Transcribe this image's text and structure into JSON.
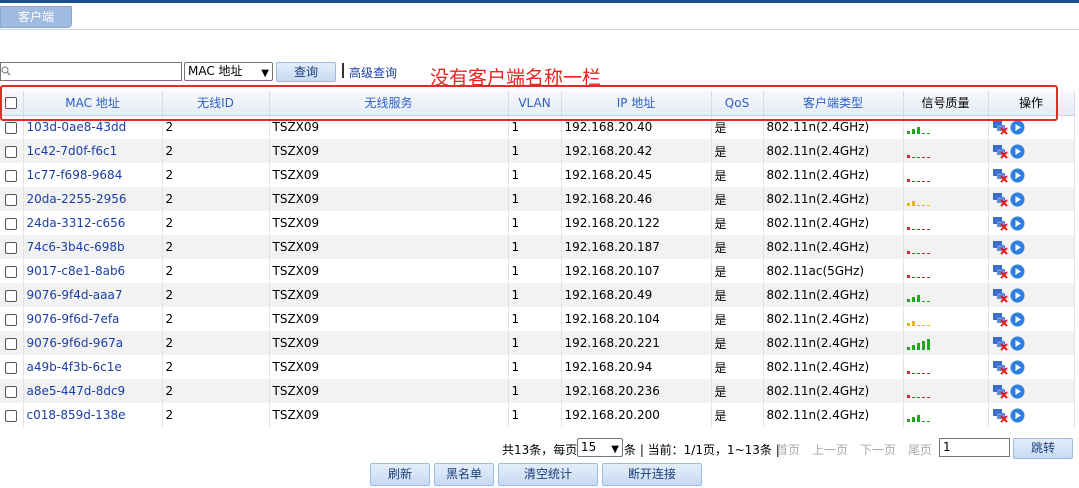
{
  "tab": {
    "label": "客户端"
  },
  "search": {
    "value": "",
    "field_selected": "MAC 地址",
    "query_button": "查询",
    "advanced_link": "高级查询"
  },
  "annotation": "没有客户端名称一栏",
  "table": {
    "headers": [
      "MAC 地址",
      "无线ID",
      "无线服务",
      "VLAN",
      "IP 地址",
      "QoS",
      "客户端类型",
      "信号质量",
      "操作"
    ],
    "rows": [
      {
        "mac": "103d-0ae8-43dd",
        "wid": "2",
        "svc": "TSZX09",
        "vlan": "1",
        "ip": "192.168.20.40",
        "qos": "是",
        "type": "802.11n(2.4GHz)",
        "signal": 3,
        "signal_color": "#1fa81f"
      },
      {
        "mac": "1c42-7d0f-f6c1",
        "wid": "2",
        "svc": "TSZX09",
        "vlan": "1",
        "ip": "192.168.20.42",
        "qos": "是",
        "type": "802.11n(2.4GHz)",
        "signal": 1,
        "signal_color": "#d42a1a"
      },
      {
        "mac": "1c77-f698-9684",
        "wid": "2",
        "svc": "TSZX09",
        "vlan": "1",
        "ip": "192.168.20.45",
        "qos": "是",
        "type": "802.11n(2.4GHz)",
        "signal": 1,
        "signal_color": "#d42a1a"
      },
      {
        "mac": "20da-2255-2956",
        "wid": "2",
        "svc": "TSZX09",
        "vlan": "1",
        "ip": "192.168.20.46",
        "qos": "是",
        "type": "802.11n(2.4GHz)",
        "signal": 2,
        "signal_color": "#e8b800"
      },
      {
        "mac": "24da-3312-c656",
        "wid": "2",
        "svc": "TSZX09",
        "vlan": "1",
        "ip": "192.168.20.122",
        "qos": "是",
        "type": "802.11n(2.4GHz)",
        "signal": 1,
        "signal_color": "#d42a1a"
      },
      {
        "mac": "74c6-3b4c-698b",
        "wid": "2",
        "svc": "TSZX09",
        "vlan": "1",
        "ip": "192.168.20.187",
        "qos": "是",
        "type": "802.11n(2.4GHz)",
        "signal": 1,
        "signal_color": "#d42a1a"
      },
      {
        "mac": "9017-c8e1-8ab6",
        "wid": "2",
        "svc": "TSZX09",
        "vlan": "1",
        "ip": "192.168.20.107",
        "qos": "是",
        "type": "802.11ac(5GHz)",
        "signal": 1,
        "signal_color": "#d42a1a"
      },
      {
        "mac": "9076-9f4d-aaa7",
        "wid": "2",
        "svc": "TSZX09",
        "vlan": "1",
        "ip": "192.168.20.49",
        "qos": "是",
        "type": "802.11n(2.4GHz)",
        "signal": 3,
        "signal_color": "#1fa81f"
      },
      {
        "mac": "9076-9f6d-7efa",
        "wid": "2",
        "svc": "TSZX09",
        "vlan": "1",
        "ip": "192.168.20.104",
        "qos": "是",
        "type": "802.11n(2.4GHz)",
        "signal": 2,
        "signal_color": "#e8b800"
      },
      {
        "mac": "9076-9f6d-967a",
        "wid": "2",
        "svc": "TSZX09",
        "vlan": "1",
        "ip": "192.168.20.221",
        "qos": "是",
        "type": "802.11n(2.4GHz)",
        "signal": 5,
        "signal_color": "#1fa81f"
      },
      {
        "mac": "a49b-4f3b-6c1e",
        "wid": "2",
        "svc": "TSZX09",
        "vlan": "1",
        "ip": "192.168.20.94",
        "qos": "是",
        "type": "802.11n(2.4GHz)",
        "signal": 1,
        "signal_color": "#d42a1a"
      },
      {
        "mac": "a8e5-447d-8dc9",
        "wid": "2",
        "svc": "TSZX09",
        "vlan": "1",
        "ip": "192.168.20.236",
        "qos": "是",
        "type": "802.11n(2.4GHz)",
        "signal": 1,
        "signal_color": "#d42a1a"
      },
      {
        "mac": "c018-859d-138e",
        "wid": "2",
        "svc": "TSZX09",
        "vlan": "1",
        "ip": "192.168.20.200",
        "qos": "是",
        "type": "802.11n(2.4GHz)",
        "signal": 3,
        "signal_color": "#1fa81f"
      }
    ]
  },
  "pager": {
    "total": "共13条，每页",
    "per_page": "15",
    "per_page_suffix": "条 | 当前：1/1页，1~13条 |",
    "first": "首页",
    "prev": "上一页",
    "next": "下一页",
    "last": "尾页",
    "page_value": "1",
    "jump": "跳转"
  },
  "buttons": {
    "refresh": "刷新",
    "blacklist": "黑名单",
    "clear_stats": "清空统计",
    "disconnect": "断开连接"
  }
}
